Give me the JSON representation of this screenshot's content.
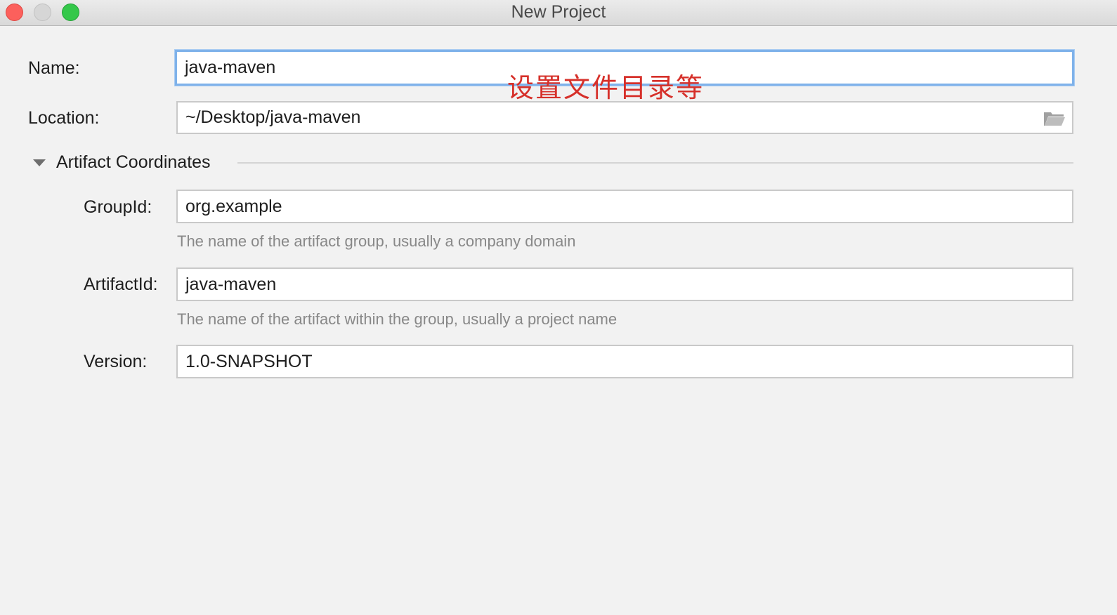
{
  "window": {
    "title": "New Project"
  },
  "form": {
    "name_label": "Name:",
    "name_value": "java-maven",
    "location_label": "Location:",
    "location_value": "~/Desktop/java-maven",
    "section_title": "Artifact Coordinates",
    "groupid_label": "GroupId:",
    "groupid_value": "org.example",
    "groupid_hint": "The name of the artifact group, usually a company domain",
    "artifactid_label": "ArtifactId:",
    "artifactid_value": "java-maven",
    "artifactid_hint": "The name of the artifact within the group, usually a project name",
    "version_label": "Version:",
    "version_value": "1.0-SNAPSHOT"
  },
  "annotation": {
    "text": "设置文件目录等",
    "color": "#d6302a"
  },
  "icons": {
    "browse": "folder-icon",
    "toggle": "triangle-down-icon"
  },
  "colors": {
    "focus_border": "#7fb2ea",
    "close": "#fc605c",
    "zoom": "#34c84a"
  }
}
